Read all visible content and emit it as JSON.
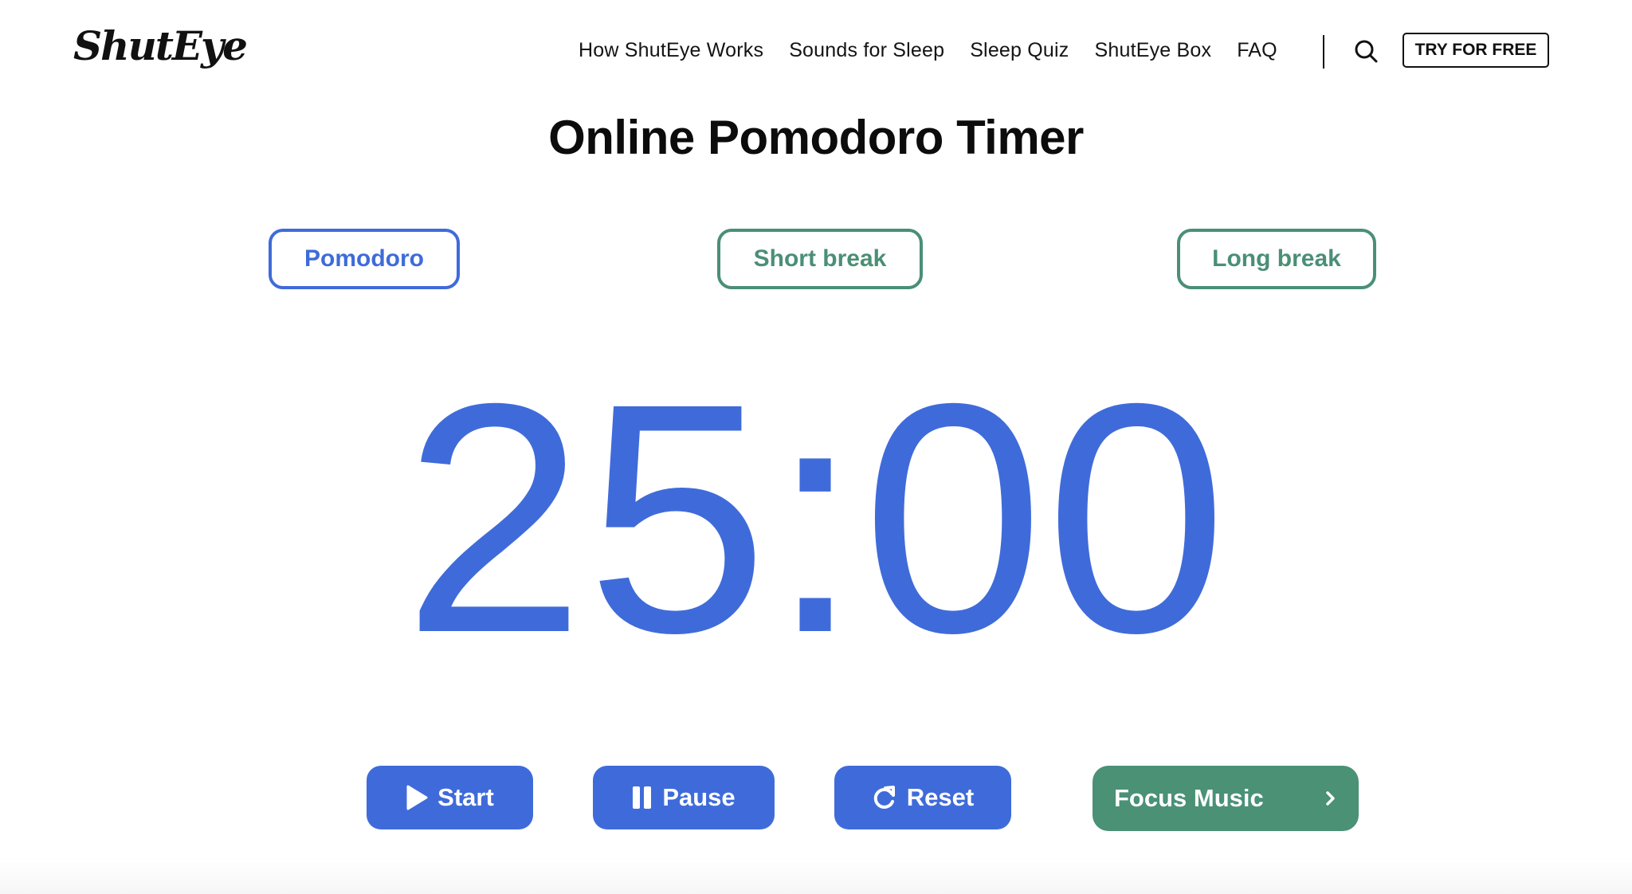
{
  "header": {
    "logo": "ShutEye",
    "nav": [
      {
        "label": "How ShutEye Works"
      },
      {
        "label": "Sounds for Sleep"
      },
      {
        "label": "Sleep Quiz"
      },
      {
        "label": "ShutEye Box"
      },
      {
        "label": "FAQ"
      }
    ],
    "search_icon": "search-icon",
    "cta_label": "TRY FOR FREE"
  },
  "page": {
    "title": "Online Pomodoro Timer"
  },
  "modes": {
    "active": "Pomodoro",
    "tabs": [
      {
        "label": "Pomodoro",
        "color": "#3f6bda"
      },
      {
        "label": "Short break",
        "color": "#4a8f76"
      },
      {
        "label": "Long break",
        "color": "#4a8f76"
      }
    ]
  },
  "timer": {
    "display": "25:00",
    "minutes": 25,
    "seconds": 0,
    "color": "#3f6bda"
  },
  "controls": {
    "start": {
      "label": "Start",
      "icon": "play-icon"
    },
    "pause": {
      "label": "Pause",
      "icon": "pause-icon"
    },
    "reset": {
      "label": "Reset",
      "icon": "reset-icon"
    },
    "focus_music": {
      "label": "Focus Music",
      "icon": "chevron-right-icon"
    }
  },
  "colors": {
    "primary_blue": "#3f6bda",
    "accent_green": "#4a9176",
    "text_dark": "#111111"
  }
}
